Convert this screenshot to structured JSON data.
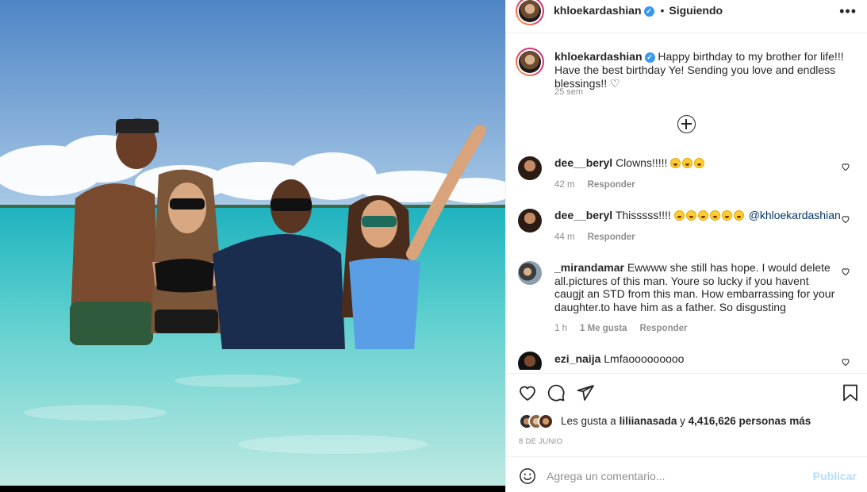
{
  "post": {
    "username": "khloekardashian",
    "verified_icon": "verified-badge-icon",
    "verified_glyph": "✓",
    "separator": "•",
    "follow_status": "Siguiendo",
    "more_glyph": "•••"
  },
  "caption": {
    "username": "khloekardashian",
    "text": "Happy birthday to my brother for life!!! Have the best birthday Ye! Sending you love and endless blessings!! ♡",
    "time": "25 sem"
  },
  "comments": [
    {
      "username": "dee__beryl",
      "text": "Clowns!!!!!",
      "emoji_count": 3,
      "mention": "",
      "time": "42 m",
      "likes": "",
      "reply": "Responder"
    },
    {
      "username": "dee__beryl",
      "text": "Thisssss!!!!",
      "emoji_count": 6,
      "mention": "@khloekardashian",
      "time": "44 m",
      "likes": "",
      "reply": "Responder"
    },
    {
      "username": "_mirandamar",
      "text": "Ewwww she still has hope. I would delete all.pictures of this man. Youre so lucky if you havent caugjt an STD from this man. How embarrassing for your daughter.to have him as a father. So disgusting",
      "emoji_count": 0,
      "mention": "",
      "time": "1 h",
      "likes": "1 Me gusta",
      "reply": "Responder"
    },
    {
      "username": "ezi_naija",
      "text": "Lmfaooooooooo",
      "emoji_count": 0,
      "mention": "",
      "time": "",
      "likes": "",
      "reply": ""
    }
  ],
  "likes": {
    "prefix": "Les gusta a",
    "user": "liliianasada",
    "joiner": "y",
    "count": "4,416,626 personas más"
  },
  "date": "8 DE JUNIO",
  "add_comment": {
    "placeholder": "Agrega un comentario...",
    "publish": "Publicar"
  },
  "colors": {
    "link": "#00376b",
    "verified": "#3897f0",
    "publish_disabled": "#b2dffc",
    "muted": "#8e8e8e"
  }
}
